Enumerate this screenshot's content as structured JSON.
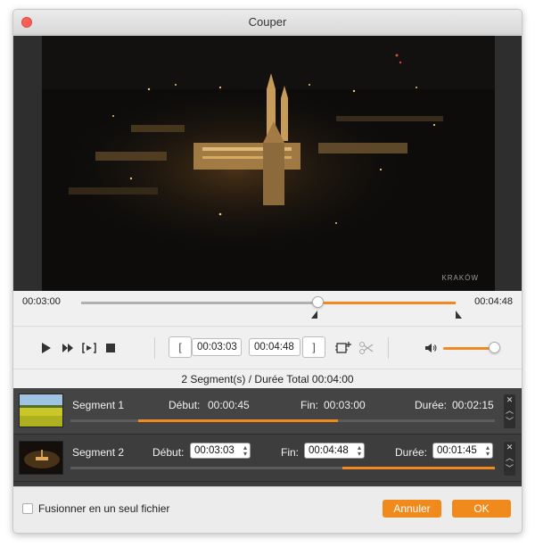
{
  "window": {
    "title": "Couper"
  },
  "video": {
    "watermark_text": "KRAKÓW"
  },
  "timeline": {
    "start_time": "00:03:00",
    "end_time": "00:04:48",
    "playhead_fraction": 0.63,
    "range_start_fraction": 0.63,
    "range_end_fraction": 1.0
  },
  "controls": {
    "start_time": "00:03:03",
    "end_time": "00:04:48",
    "start_bracket": "[",
    "end_bracket": "]",
    "volume_fraction": 1.0
  },
  "summary": "2 Segment(s) / Durée Total 00:04:00",
  "segments": [
    {
      "name": "Segment 1",
      "start_label": "Début:",
      "start": "00:00:45",
      "end_label": "Fin:",
      "end": "00:03:00",
      "duration_label": "Durée:",
      "duration": "00:02:15",
      "fill_start": 0.16,
      "fill_end": 0.63
    },
    {
      "name": "Segment 2",
      "start_label": "Début:",
      "start": "00:03:03",
      "end_label": "Fin:",
      "end": "00:04:48",
      "duration_label": "Durée:",
      "duration": "00:01:45",
      "fill_start": 0.64,
      "fill_end": 1.0
    }
  ],
  "footer": {
    "merge_label": "Fusionner en un seul fichier",
    "cancel_label": "Annuler",
    "ok_label": "OK"
  },
  "colors": {
    "accent": "#f18a1c",
    "close": "#fc5f57"
  },
  "icons": [
    "close-icon",
    "play-icon",
    "fast-forward-icon",
    "snap-to-frame-icon",
    "stop-icon",
    "add-segment-icon",
    "split-icon",
    "volume-icon",
    "delete-segment-icon",
    "move-up-icon",
    "move-down-icon"
  ]
}
